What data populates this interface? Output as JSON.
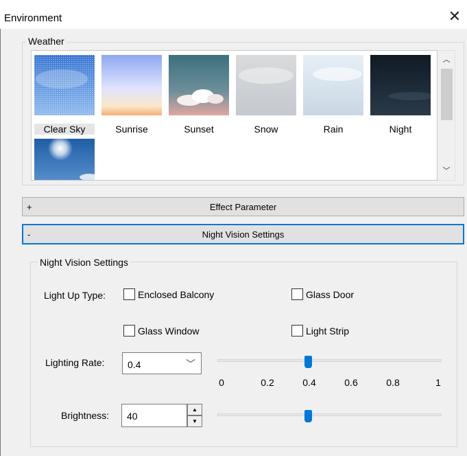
{
  "window": {
    "title": "Environment",
    "close_icon": "close-icon"
  },
  "weather": {
    "group_title": "Weather",
    "items": [
      {
        "label": "Clear Sky",
        "selected": true
      },
      {
        "label": "Sunrise"
      },
      {
        "label": "Sunset"
      },
      {
        "label": "Snow"
      },
      {
        "label": "Rain"
      },
      {
        "label": "Night"
      },
      {
        "label": ""
      }
    ],
    "scroll_up_icon": "chevron-up-icon",
    "scroll_down_icon": "chevron-down-icon"
  },
  "sections": {
    "effect": {
      "sign": "+",
      "label": "Effect Parameter"
    },
    "night_vision": {
      "sign": "-",
      "label": "Night Vision Settings"
    }
  },
  "night_vision": {
    "group_title": "Night Vision Settings",
    "light_up_type_label": "Light Up Type:",
    "checkboxes": {
      "enclosed_balcony": {
        "label": "Enclosed Balcony",
        "checked": false
      },
      "glass_door": {
        "label": "Glass Door",
        "checked": false
      },
      "glass_window": {
        "label": "Glass Window",
        "checked": false
      },
      "light_strip": {
        "label": "Light Strip",
        "checked": false
      }
    },
    "lighting_rate": {
      "label": "Lighting Rate:",
      "value": "0.4",
      "slider_fraction": 0.4,
      "ticks": [
        "0",
        "0.2",
        "0.4",
        "0.6",
        "0.8",
        "1"
      ]
    },
    "brightness": {
      "label": "Brightness:",
      "value": "40",
      "slider_fraction": 0.4
    }
  },
  "colors": {
    "accent": "#0078d7"
  }
}
